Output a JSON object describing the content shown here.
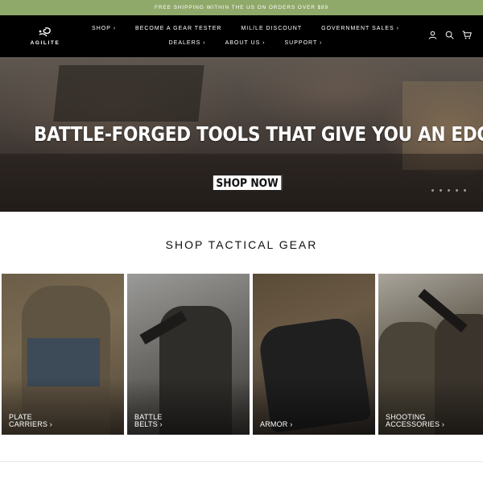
{
  "announcement": "FREE SHIPPING WITHIN THE US ON ORDERS OVER $89",
  "brand": {
    "logo_text": "AGILITE"
  },
  "nav": {
    "row1": [
      {
        "label": "SHOP ›"
      },
      {
        "label": "BECOME A GEAR TESTER"
      },
      {
        "label": "MIL/LE DISCOUNT"
      },
      {
        "label": "GOVERNMENT SALES ›"
      }
    ],
    "row2": [
      {
        "label": "DEALERS ›"
      },
      {
        "label": "ABOUT US ›"
      },
      {
        "label": "SUPPORT ›"
      }
    ]
  },
  "utility_icons": [
    "account-icon",
    "search-icon",
    "cart-icon"
  ],
  "hero": {
    "title": "BATTLE-FORGED TOOLS THAT GIVE YOU AN EDGE",
    "cta": "SHOP NOW",
    "slides_count": 5
  },
  "section": {
    "title": "SHOP TACTICAL GEAR"
  },
  "categories": [
    {
      "line1": "PLATE",
      "line2": "CARRIERS ›"
    },
    {
      "line1": "BATTLE",
      "line2": "BELTS ›"
    },
    {
      "line1": "",
      "line2": "ARMOR ›"
    },
    {
      "line1": "SHOOTING",
      "line2": "ACCESSORIES ›"
    }
  ],
  "colors": {
    "announcement_bg": "#8fa96a",
    "nav_bg": "#000000"
  }
}
